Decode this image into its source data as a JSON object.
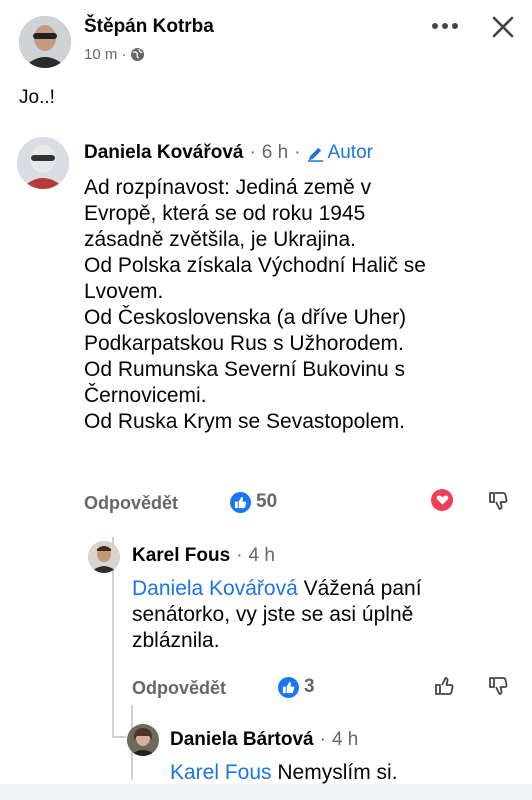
{
  "post": {
    "author": "Štěpán Kotrba",
    "time": "10 m",
    "privacy_sep": "·",
    "text": "Jo..!",
    "more_icon": "more-horizontal-icon",
    "close_icon": "close-icon",
    "privacy_icon": "globe-icon"
  },
  "comments": [
    {
      "author": "Daniela Kovářová",
      "sep": "·",
      "time": "6 h",
      "badge": "Autor",
      "badge_icon": "pencil-icon",
      "lines": [
        "Ad rozpínavost: Jediná země v",
        "Evropě, která se od roku 1945",
        "zásadně zvětšila, je Ukrajina.",
        "Od Polska získala Východní Halič se",
        "Lvovem.",
        "Od Československa (a dříve Uher)",
        "Podkarpatskou Rus s Užhorodem.",
        "Od Rumunska Severní Bukovinu s",
        "Černovicemi.",
        "Od Ruska Krym se Sevastopolem."
      ],
      "reply_label": "Odpovědět",
      "likes": "50"
    }
  ],
  "replies": [
    {
      "author": "Karel Fous",
      "sep": "·",
      "time": "4 h",
      "mention": "Daniela Kovářová",
      "line1_rest": " Vážená paní",
      "line2": "senátorko, vy jste se asi úplně",
      "line3": "zbláznila.",
      "reply_label": "Odpovědět",
      "likes": "3"
    },
    {
      "author": "Daniela Bártová",
      "sep": "·",
      "time": "4 h",
      "mention": "Karel Fous",
      "text_rest": " Nemyslím si."
    }
  ],
  "colors": {
    "link": "#1b74e4",
    "meta": "#65676b",
    "like": "#1877f2",
    "love": "#f33e58"
  }
}
